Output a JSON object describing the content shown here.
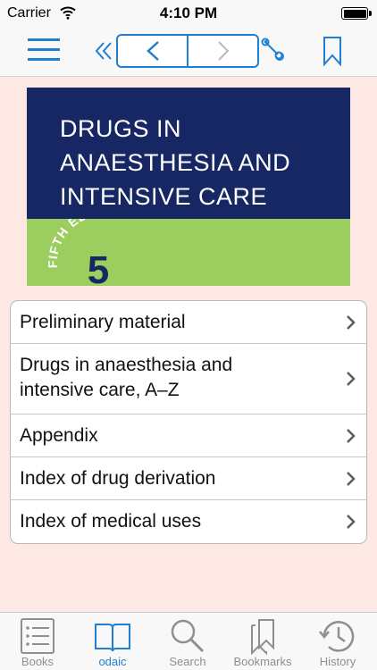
{
  "status_bar": {
    "carrier": "Carrier",
    "time": "4:10 PM"
  },
  "cover": {
    "title_lines": [
      "DRUGS IN",
      "ANAESTHESIA AND",
      "INTENSIVE CARE"
    ],
    "edition_label": "FIFTH EDITION",
    "edition_number": "5",
    "colors": {
      "top": "#172764",
      "bottom": "#9bce5e"
    }
  },
  "menu": {
    "items": [
      {
        "label_lines": [
          "Preliminary material"
        ]
      },
      {
        "label_lines": [
          "Drugs in anaesthesia and",
          "intensive care, A–Z"
        ]
      },
      {
        "label_lines": [
          "Appendix"
        ]
      },
      {
        "label_lines": [
          "Index of drug derivation"
        ]
      },
      {
        "label_lines": [
          "Index of medical uses"
        ]
      }
    ]
  },
  "tabs": [
    {
      "label": "Books",
      "icon": "books-icon",
      "active": false
    },
    {
      "label": "odaic",
      "icon": "open-book-icon",
      "active": true
    },
    {
      "label": "Search",
      "icon": "search-icon",
      "active": false
    },
    {
      "label": "Bookmarks",
      "icon": "bookmarks-icon",
      "active": false
    },
    {
      "label": "History",
      "icon": "history-icon",
      "active": false
    }
  ],
  "colors": {
    "accent": "#1f7fd1",
    "background": "#fde8e4",
    "inactive": "#8e8e93"
  }
}
